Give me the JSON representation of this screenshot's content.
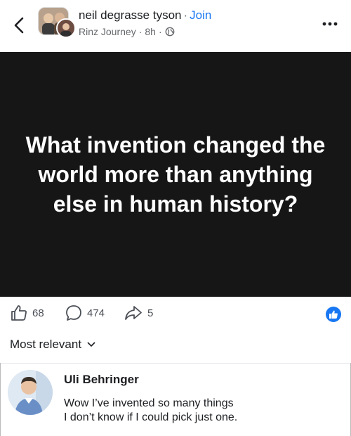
{
  "header": {
    "group_name": "neil degrasse tyson",
    "separator": "·",
    "join_label": "Join",
    "author": "Rinz Journey",
    "time": "8h",
    "visibility_icon": "globe-icon"
  },
  "post": {
    "text": "What invention changed the world more than anything else in human history?",
    "background_color": "#161616"
  },
  "reactions": {
    "likes": "68",
    "comments": "474",
    "shares": "5"
  },
  "sort": {
    "label": "Most relevant"
  },
  "comment": {
    "author": "Uli Behringer",
    "line1": "Wow I’ve invented so many things",
    "line2": "I don’t know if I could pick just one."
  },
  "colors": {
    "accent": "#1877f2",
    "muted": "#65676b"
  }
}
